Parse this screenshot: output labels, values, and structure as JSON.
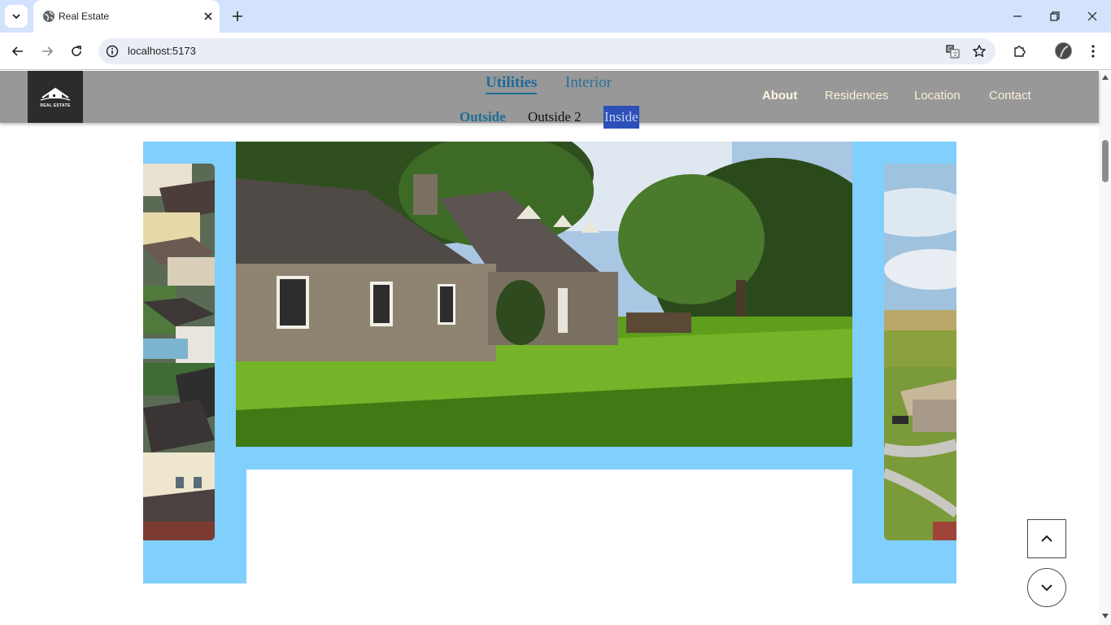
{
  "browser": {
    "tab_title": "Real Estate",
    "url": "localhost:5173"
  },
  "site": {
    "logo_text": "REAL ESTATE",
    "gallery_tabs": [
      "Utilities",
      "Interior"
    ],
    "active_gallery_tab": "Utilities",
    "sub_tabs": [
      "Outside",
      "Outside 2",
      "Inside"
    ],
    "active_sub_tab": "Outside",
    "selected_sub_tab": "Inside",
    "nav": [
      "About",
      "Residences",
      "Location",
      "Contact"
    ],
    "active_nav": "About"
  },
  "colors": {
    "header_bg": "#989898",
    "gallery_bg": "#80cffc",
    "accent_blue": "#1d6c97",
    "nav_text": "#faf0d7"
  },
  "icons": {
    "scroll_up": "chevron-up-icon",
    "scroll_down": "chevron-down-icon"
  }
}
